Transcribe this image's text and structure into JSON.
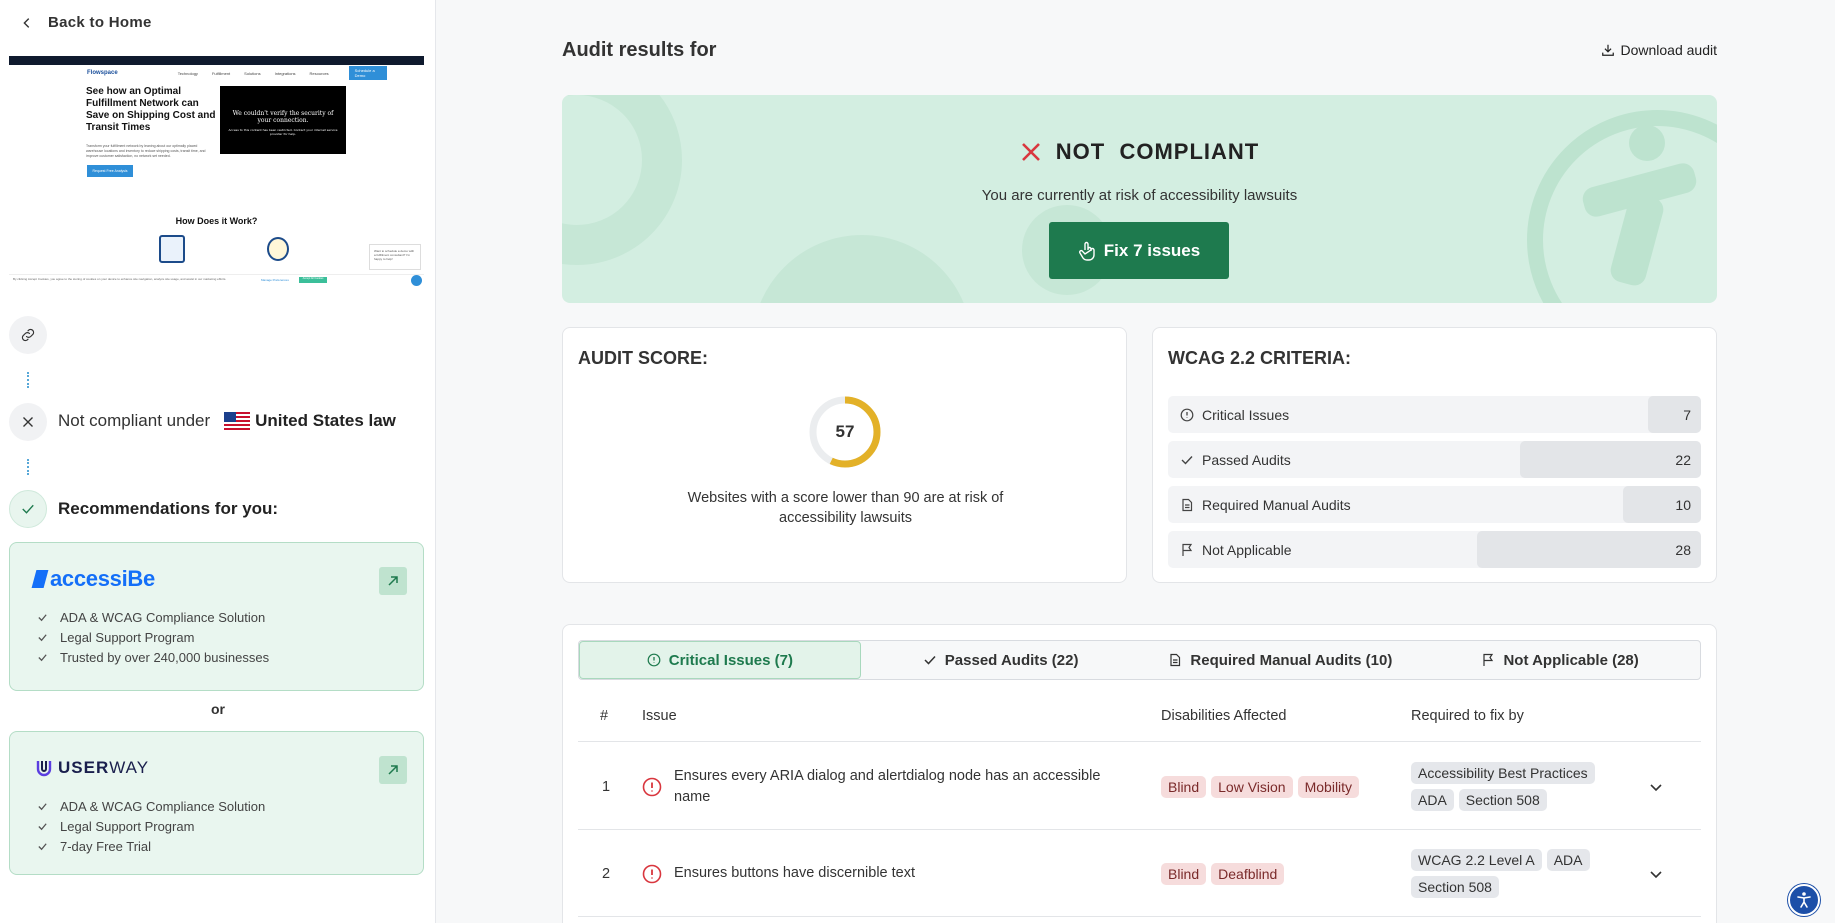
{
  "sidebar": {
    "back_label": "Back to Home",
    "preview": {
      "logo": "Flowspace",
      "nav_items": [
        "Technology",
        "Fulfillment",
        "Solutions",
        "Integrations",
        "Resources"
      ],
      "nav_top": [
        "About",
        "Sign In"
      ],
      "nav_button": "Schedule a Demo",
      "hero_title": "See how an Optimal Fulfillment Network can Save on Shipping Cost and Transit Times",
      "hero_sub": "Transform your fulfillment network by leaning about our optimally placed warehouse locations and inventory to reduce shipping costs, transit time, and improve customer satisfaction, no network set needed.",
      "hero_button": "Request Free Analysis",
      "modal_text": "We couldn't verify the security of your connection.",
      "modal_sub": "Access to this content has been restricted. Contact your internet service provider for help.",
      "how_title": "How Does it Work?",
      "chat_text": "Want to schedule a demo with a fulfillment consultant? I'm happy to help!",
      "footer_text": "By clicking Accept Cookies, you agree to the storing of cookies on your device to enhance site navigation, analyze site usage, and assist in our marketing efforts.",
      "footer_manage": "Manage Preferences",
      "footer_accept": "Accept All Cookies"
    },
    "status_prefix": "Not compliant under",
    "country": "United States law",
    "recommendations_title": "Recommendations for you:",
    "cards": [
      {
        "brand": "accessiBe",
        "features": [
          "ADA & WCAG Compliance Solution",
          "Legal Support Program",
          "Trusted by over 240,000 businesses"
        ]
      },
      {
        "brand_bold": "USER",
        "brand_light": "WAY",
        "features": [
          "ADA & WCAG Compliance Solution",
          "Legal Support Program",
          "7-day Free Trial"
        ]
      }
    ],
    "or_label": "or"
  },
  "header": {
    "title": "Audit results for",
    "download_label": "Download audit"
  },
  "banner": {
    "status": "NOT  COMPLIANT",
    "subtext": "You are currently at risk of accessibility lawsuits",
    "fix_label": "Fix 7 issues"
  },
  "score": {
    "title": "AUDIT SCORE:",
    "value": 57,
    "note": "Websites with a score lower than 90 are at risk of accessibility lawsuits",
    "ring_color": "#e3b128"
  },
  "wcag": {
    "title": "WCAG 2.2 CRITERIA:",
    "rows": [
      {
        "label": "Critical Issues",
        "value": "7",
        "icon": "alert-circle-icon",
        "share": 0.1
      },
      {
        "label": "Passed Audits",
        "value": "22",
        "icon": "check-icon",
        "share": 0.34
      },
      {
        "label": "Required Manual Audits",
        "value": "10",
        "icon": "document-icon",
        "share": 0.146
      },
      {
        "label": "Not Applicable",
        "value": "28",
        "icon": "flag-icon",
        "share": 0.42
      }
    ]
  },
  "tabs": [
    {
      "label": "Critical Issues (7)",
      "icon": "alert-circle-icon",
      "active": true
    },
    {
      "label": "Passed Audits (22)",
      "icon": "check-icon",
      "active": false
    },
    {
      "label": "Required Manual Audits (10)",
      "icon": "document-icon",
      "active": false
    },
    {
      "label": "Not Applicable (28)",
      "icon": "flag-icon",
      "active": false
    }
  ],
  "table": {
    "headers": {
      "num": "#",
      "issue": "Issue",
      "disabilities": "Disabilities Affected",
      "required": "Required to fix by"
    },
    "rows": [
      {
        "num": "1",
        "issue": "Ensures every ARIA dialog and alertdialog node has an accessible name",
        "disabilities": [
          "Blind",
          "Low Vision",
          "Mobility"
        ],
        "required": [
          "Accessibility Best Practices",
          "ADA",
          "Section 508"
        ]
      },
      {
        "num": "2",
        "issue": "Ensures buttons have discernible text",
        "disabilities": [
          "Blind",
          "Deafblind"
        ],
        "required": [
          "WCAG 2.2 Level A",
          "ADA",
          "Section 508"
        ]
      }
    ]
  },
  "colors": {
    "accent_green": "#1e7a4e",
    "error_red": "#d9363e",
    "banner_bg": "#d3eee1"
  }
}
